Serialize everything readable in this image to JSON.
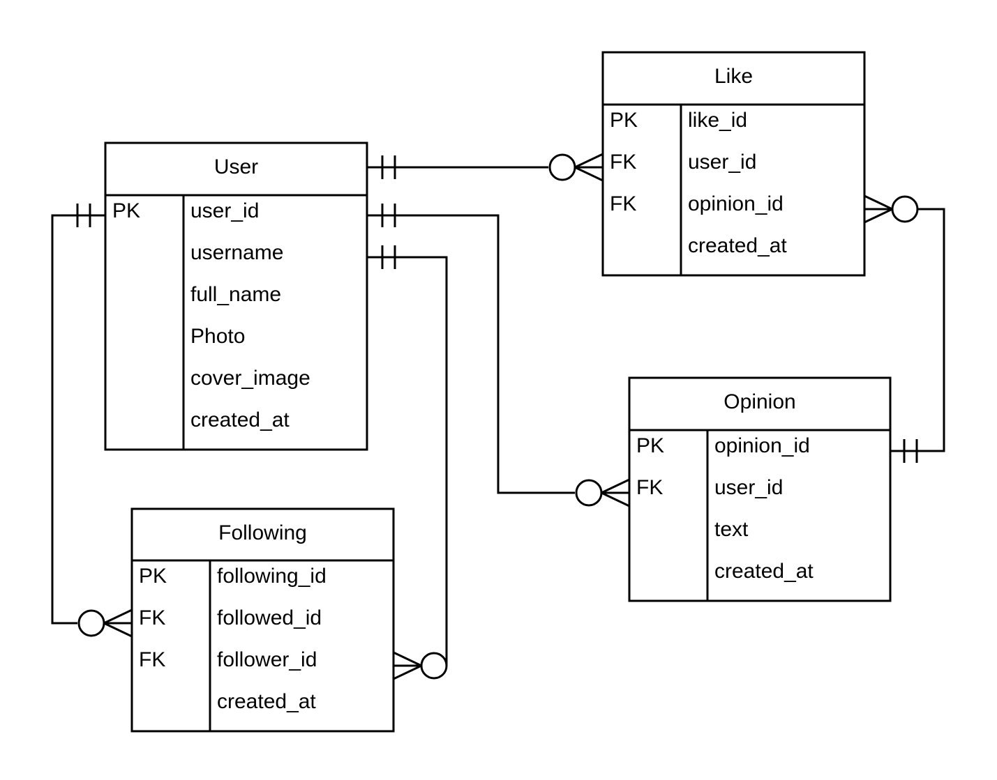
{
  "diagram": {
    "type": "entity-relationship",
    "colors": {
      "stroke": "#000000",
      "background": "#ffffff",
      "text": "#000000"
    },
    "entities": [
      {
        "id": "user",
        "name": "User",
        "attributes": [
          {
            "key": "PK",
            "name": "user_id"
          },
          {
            "key": "",
            "name": "username"
          },
          {
            "key": "",
            "name": "full_name"
          },
          {
            "key": "",
            "name": "Photo"
          },
          {
            "key": "",
            "name": "cover_image"
          },
          {
            "key": "",
            "name": "created_at"
          }
        ]
      },
      {
        "id": "like",
        "name": "Like",
        "attributes": [
          {
            "key": "PK",
            "name": "like_id"
          },
          {
            "key": "FK",
            "name": "user_id"
          },
          {
            "key": "FK",
            "name": "opinion_id"
          },
          {
            "key": "",
            "name": "created_at"
          }
        ]
      },
      {
        "id": "opinion",
        "name": "Opinion",
        "attributes": [
          {
            "key": "PK",
            "name": "opinion_id"
          },
          {
            "key": "FK",
            "name": "user_id"
          },
          {
            "key": "",
            "name": "text"
          },
          {
            "key": "",
            "name": "created_at"
          }
        ]
      },
      {
        "id": "following",
        "name": "Following",
        "attributes": [
          {
            "key": "PK",
            "name": "following_id"
          },
          {
            "key": "FK",
            "name": "followed_id"
          },
          {
            "key": "FK",
            "name": "follower_id"
          },
          {
            "key": "",
            "name": "created_at"
          }
        ]
      }
    ],
    "relationships": [
      {
        "id": "user-like",
        "from": "User",
        "from_cardinality": "exactly-one",
        "to": "Like",
        "to_cardinality": "zero-or-many"
      },
      {
        "id": "user-opinion",
        "from": "User.user_id",
        "from_cardinality": "exactly-one",
        "to": "Opinion.user_id",
        "to_cardinality": "zero-or-many"
      },
      {
        "id": "user-following-follower",
        "from": "User.username",
        "from_cardinality": "exactly-one",
        "to": "Following.follower_id",
        "to_cardinality": "zero-or-many"
      },
      {
        "id": "user-following-followed",
        "from": "User.user_id",
        "from_cardinality": "exactly-one",
        "to": "Following.followed_id",
        "to_cardinality": "zero-or-many"
      },
      {
        "id": "opinion-like",
        "from": "Opinion.opinion_id",
        "from_cardinality": "exactly-one",
        "to": "Like.opinion_id",
        "to_cardinality": "zero-or-many"
      }
    ]
  }
}
